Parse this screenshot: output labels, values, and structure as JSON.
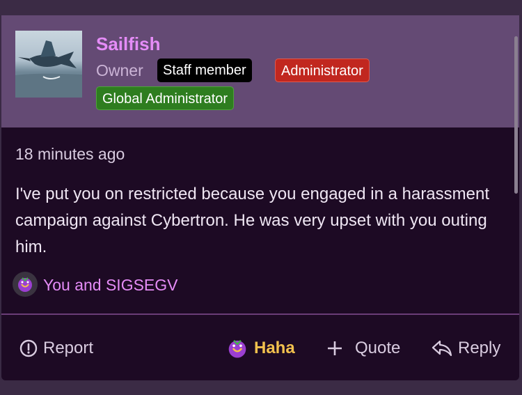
{
  "post": {
    "username": "Sailfish",
    "user_title": "Owner",
    "badges": {
      "staff": "Staff member",
      "admin": "Administrator",
      "global_admin": "Global Administrator"
    },
    "timestamp": "18 minutes ago",
    "message": "I've put you on restricted because you engaged in a harassment campaign against Cybertron. He was very upset with you outing him.",
    "reactions_text": "You and SIGSEGV"
  },
  "actions": {
    "report": "Report",
    "haha": "Haha",
    "quote": "Quote",
    "reply": "Reply"
  },
  "colors": {
    "username": "#e58cf7",
    "header_bg": "#644a74",
    "body_bg": "#1d0a24",
    "admin_badge": "#c1271f",
    "global_admin_badge": "#2e7d1f",
    "haha_active": "#f2c14e"
  },
  "icons": {
    "reaction": "haha-emoji-icon",
    "report": "alert-circle-icon",
    "quote": "plus-icon",
    "reply": "reply-arrow-icon"
  }
}
